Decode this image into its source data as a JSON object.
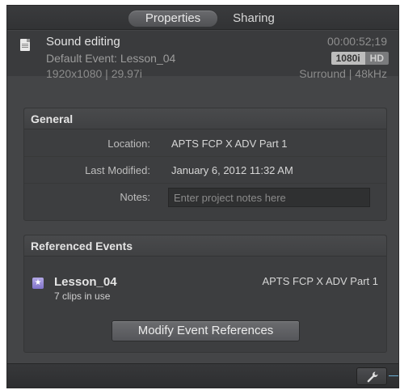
{
  "tabs": [
    {
      "label": "Properties",
      "active": true
    },
    {
      "label": "Sharing",
      "active": false
    }
  ],
  "project": {
    "icon": "document-icon",
    "name": "Sound editing",
    "event": "Default Event: Lesson_04",
    "format": "1920x1080  |  29.97i",
    "timecode": "00:00:52;19",
    "resolution_badge": "1080i",
    "hd_badge": "HD",
    "audio": "Surround  |  48kHz"
  },
  "general": {
    "title": "General",
    "location_label": "Location:",
    "location_value": "APTS FCP X ADV Part 1",
    "modified_label": "Last Modified:",
    "modified_value": "January 6, 2012 11:32 AM",
    "notes_label": "Notes:",
    "notes_placeholder": "Enter project notes here",
    "notes_value": ""
  },
  "referenced_events": {
    "title": "Referenced Events",
    "event_icon": "star-event-icon",
    "event_name": "Lesson_04",
    "clips_in_use": "7 clips in use",
    "library": "APTS FCP X ADV Part 1",
    "modify_button": "Modify Event References"
  },
  "bottom_bar": {
    "action_icon": "wrench-icon"
  },
  "colors": {
    "panel_bg": "#444547",
    "accent_edge": "#6bb0d6",
    "event_icon": "#8d80d4"
  }
}
